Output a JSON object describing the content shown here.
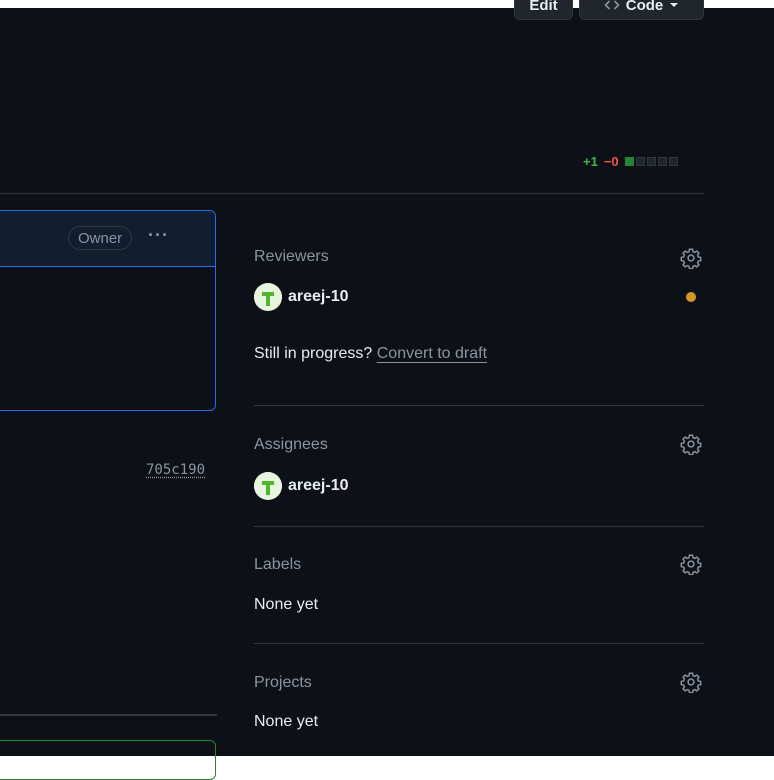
{
  "header": {
    "edit_label": "Edit",
    "code_label": "Code"
  },
  "diffstat": {
    "additions": "+1",
    "deletions": "−0",
    "blocks": [
      "green",
      "gray",
      "gray",
      "gray",
      "gray"
    ]
  },
  "comment": {
    "badge": "Owner",
    "menu": "···",
    "commit_sha": "705c190"
  },
  "sidebar": {
    "reviewers": {
      "title": "Reviewers",
      "user": "areej-10",
      "status_color": "#d29922",
      "draft_prompt": "Still in progress?",
      "draft_link": "Convert to draft"
    },
    "assignees": {
      "title": "Assignees",
      "user": "areej-10"
    },
    "labels": {
      "title": "Labels",
      "value": "None yet"
    },
    "projects": {
      "title": "Projects",
      "value": "None yet"
    }
  },
  "colors": {
    "background": "#0d1117",
    "border": "#30363d",
    "accent_blue": "#1f6feb",
    "added_green": "#3fb950",
    "deleted_red": "#f85149",
    "pending_yellow": "#d29922"
  }
}
